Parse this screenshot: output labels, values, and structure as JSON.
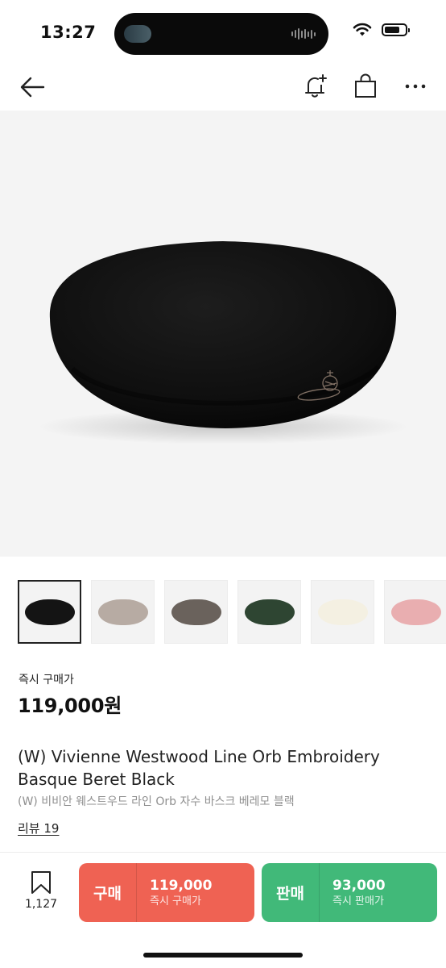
{
  "status_bar": {
    "time": "13:27"
  },
  "nav": {
    "back_icon": "arrow-left-icon",
    "alert_icon": "bell-plus-icon",
    "cart_icon": "shopping-bag-icon",
    "more_icon": "more-horizontal-icon"
  },
  "product": {
    "image_icon": "beret-photo",
    "thumbnails": [
      {
        "color": "#141414",
        "selected": true
      },
      {
        "color": "#b7aba3",
        "selected": false
      },
      {
        "color": "#6a625c",
        "selected": false
      },
      {
        "color": "#2e4532",
        "selected": false
      },
      {
        "color": "#f4f0e2",
        "selected": false
      },
      {
        "color": "#e9aeb0",
        "selected": false
      }
    ],
    "price_label": "즉시 구매가",
    "price": "119,000원",
    "title_en": "(W) Vivienne Westwood Line Orb Embroidery Basque Beret Black",
    "title_ko": "(W) 비비안 웨스트우드 라인 Orb 자수 바스크 베레모 블랙",
    "review_link": "리뷰 19"
  },
  "bottom_bar": {
    "bookmark_count": "1,127",
    "buy": {
      "label": "구매",
      "price": "119,000",
      "sub": "즉시 구매가",
      "color": "#ef6253"
    },
    "sell": {
      "label": "판매",
      "price": "93,000",
      "sub": "즉시 판매가",
      "color": "#41b979"
    }
  }
}
